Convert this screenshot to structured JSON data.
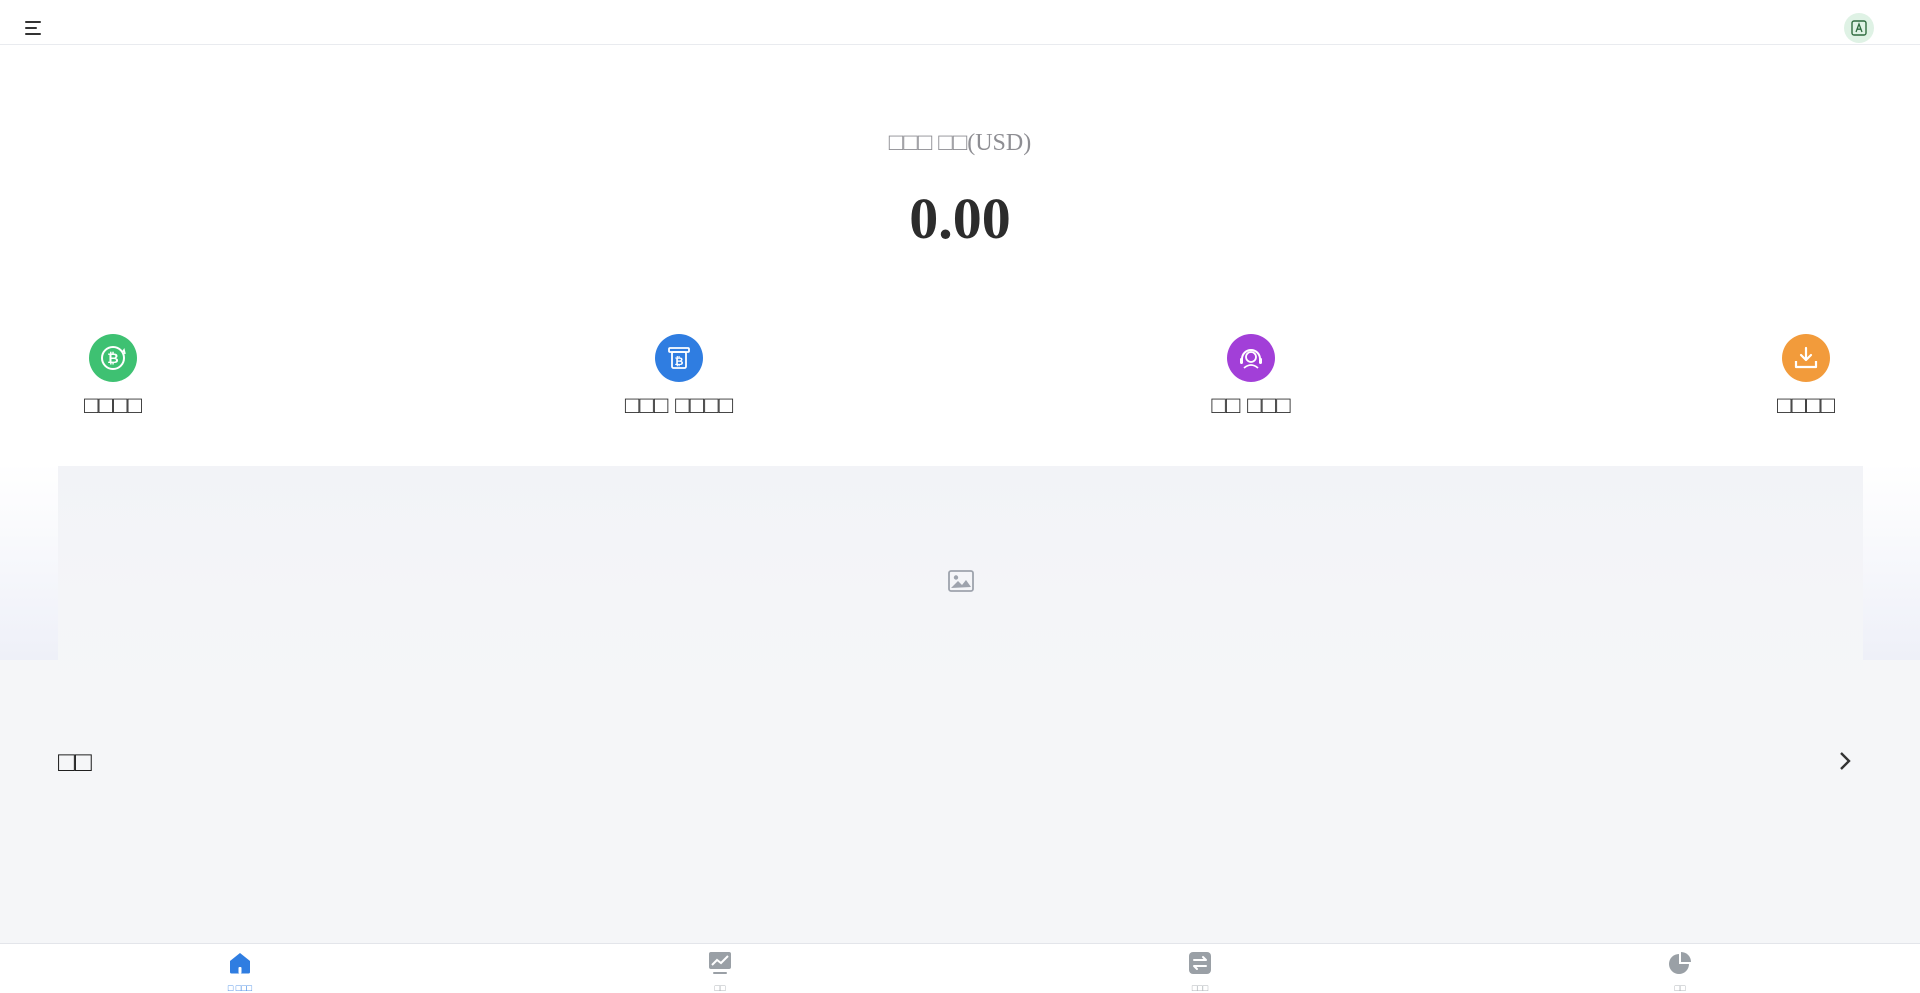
{
  "header": {
    "menu_icon": "hamburger-menu-icon",
    "avatar_icon": "translate-icon"
  },
  "balance": {
    "label": "□□□ □□(USD)",
    "value": "0.00"
  },
  "actions": [
    {
      "label": "□□□□",
      "icon": "bitcoin-exchange-icon",
      "color": "#3ec172"
    },
    {
      "label": "□□□ □□□□",
      "icon": "bitcoin-receipt-icon",
      "color": "#2f7de1"
    },
    {
      "label": "□□ □□□",
      "icon": "customer-service-icon",
      "color": "#a23fd8"
    },
    {
      "label": "□□□□",
      "icon": "download-icon",
      "color": "#f29b3b"
    }
  ],
  "banner": {
    "icon": "image-placeholder-icon"
  },
  "notice": {
    "title": "□□",
    "icon": "chevron-right-icon"
  },
  "tabs": [
    {
      "label": "□ □□□",
      "icon": "home-icon",
      "active": true
    },
    {
      "label": "□□",
      "icon": "market-chart-icon",
      "active": false
    },
    {
      "label": "□□□",
      "icon": "exchange-icon",
      "active": false
    },
    {
      "label": "□□",
      "icon": "pie-chart-icon",
      "active": false
    }
  ],
  "colors": {
    "accent": "#2f7de1",
    "inactive_tab": "#9aa0a6"
  }
}
